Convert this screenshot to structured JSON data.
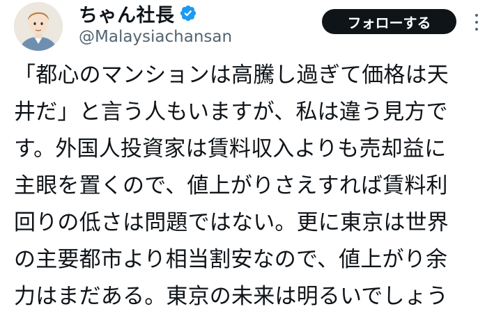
{
  "author": {
    "display_name": "ちゃん社長",
    "handle": "@Malaysiachansan",
    "verified": true
  },
  "actions": {
    "follow_label": "フォローする",
    "more_icon": "more-dots-icon"
  },
  "post": {
    "lines": [
      "「都心のマンションは高騰し過ぎて価格は天",
      "井だ」と言う人もいますが、私は違う見方で",
      "す。外国人投資家は賃料収入よりも売却益に",
      "主眼を置くので、値上がりさえすれば賃料利",
      "回りの低さは問題ではない。更に東京は世界",
      "の主要都市より相当割安なので、値上がり余",
      "力はまだある。東京の未来は明るいでしょう"
    ]
  },
  "colors": {
    "text": "#0f1419",
    "secondary": "#536471",
    "verified_badge": "#1d9bf0",
    "button_bg": "#0f1419",
    "button_text": "#ffffff"
  }
}
